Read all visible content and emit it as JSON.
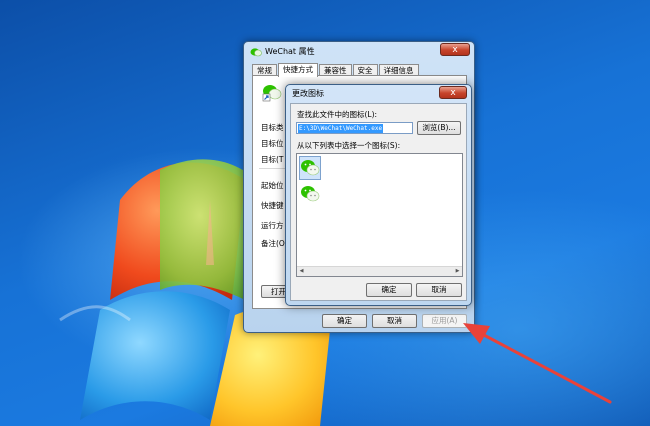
{
  "window": {
    "title": "WeChat 属性",
    "close_glyph": "x",
    "tabs": [
      "常规",
      "快捷方式",
      "兼容性",
      "安全",
      "详细信息"
    ],
    "active_tab": "快捷方式",
    "field_labels": [
      "目标类",
      "目标位",
      "目标(T",
      "起始位",
      "快捷键",
      "运行方",
      "备注(O"
    ],
    "open_button_label": "打开",
    "buttons": {
      "ok": "确定",
      "cancel": "取消",
      "apply": "应用(A)"
    }
  },
  "dialog": {
    "title": "更改图标",
    "close_glyph": "x",
    "find_label": "查找此文件中的图标(L):",
    "path_value": "E:\\3D\\WeChat\\WeChat.exe",
    "browse_label": "浏览(B)...",
    "select_label": "从以下列表中选择一个图标(S):",
    "icon_count": 2,
    "selected_index": 0,
    "buttons": {
      "ok": "确定",
      "cancel": "取消"
    }
  },
  "annotation": {
    "arrow_color": "#e8423a"
  },
  "colors": {
    "desktop": "#1a6fc9",
    "wechat_green": "#2dc100",
    "selection": "#3399ff"
  }
}
